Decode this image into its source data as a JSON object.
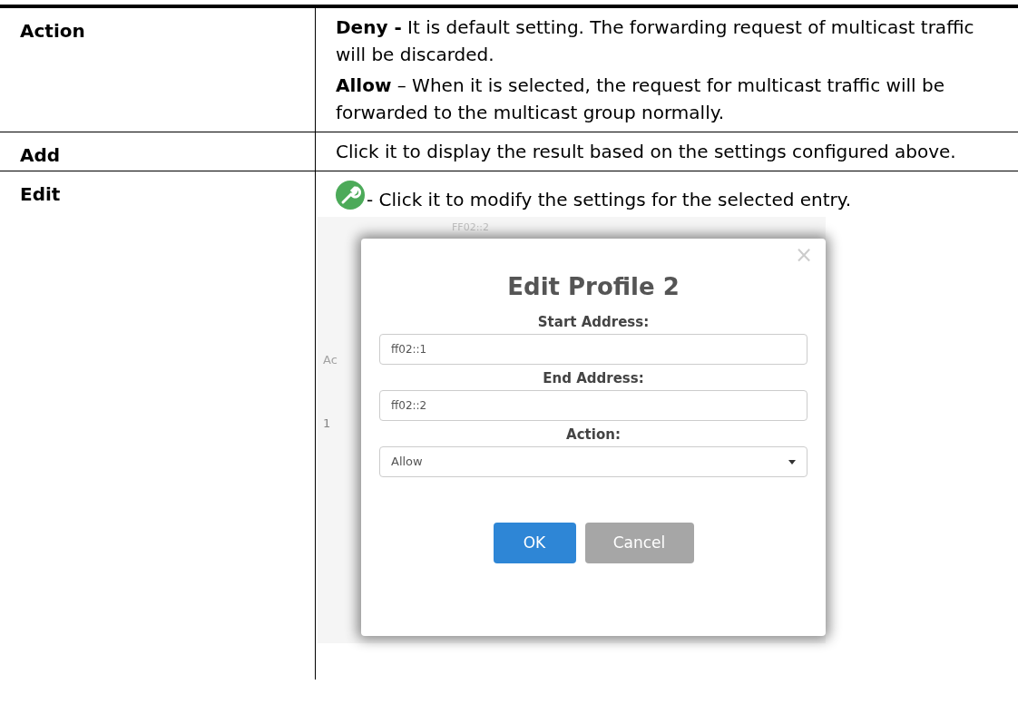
{
  "rows": [
    {
      "label": "Action",
      "paragraphs": [
        "**Deny -** It is default setting. The forwarding request of multicast traffic will be discarded.",
        "**Allow** – When it is selected, the request for multicast traffic will be forwarded to the multicast group normally."
      ]
    },
    {
      "label": "Add",
      "paragraphs": [
        "Click it to display the result based on the settings configured above."
      ]
    },
    {
      "label": "Edit",
      "icon_note": "- Click it to modify the settings for the selected entry.",
      "screenshot": {
        "background_texts": [
          "FF02::2",
          "Ac",
          "1"
        ],
        "dialog": {
          "title": "Edit Profile 2",
          "close": "×",
          "fields": [
            {
              "kind": "text",
              "label": "Start Address:",
              "value": "ff02::1"
            },
            {
              "kind": "text",
              "label": "End Address:",
              "value": "ff02::2"
            },
            {
              "kind": "select",
              "label": "Action:",
              "value": "Allow"
            }
          ],
          "buttons": [
            {
              "label": "OK",
              "kind": "primary"
            },
            {
              "label": "Cancel",
              "kind": "secondary"
            }
          ]
        }
      }
    }
  ]
}
